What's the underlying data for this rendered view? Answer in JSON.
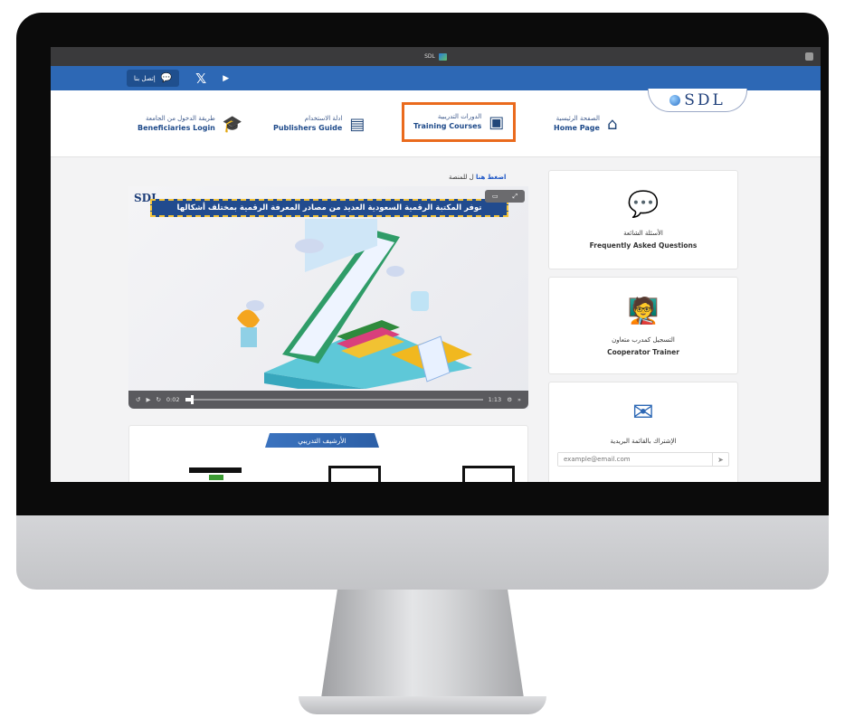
{
  "window": {
    "title": "SDL"
  },
  "topbar": {
    "contact_label": "إتصل بنا"
  },
  "logo": {
    "text": "SDL"
  },
  "menu": {
    "home": {
      "ar": "الصفحة الرئيسية",
      "en": "Home Page"
    },
    "training": {
      "ar": "الدورات التدريبية",
      "en": "Training Courses"
    },
    "publishers": {
      "ar": "ادلة الاستخدام",
      "en": "Publishers Guide"
    },
    "beneficiaries": {
      "ar": "طريقة الدخول من الجامعة",
      "en": "Beneficiaries Login"
    }
  },
  "content": {
    "link_prefix": "ل للمنصة",
    "link_action": "اضغط هنا",
    "video_logo": "SDL",
    "video_banner": "توفر المكتبة الرقمية السعودية العديد من مصادر المعرفة الرقمية بمختلف أشكالها",
    "video_time_current": "0:02",
    "video_time_total": "1:13",
    "video_progress": 0.02,
    "archive_title": "الأرشيف التدريبي"
  },
  "cards": {
    "faq": {
      "ar": "الأسئلة الشائعة",
      "en": "Frequently Asked Questions",
      "icon": "speech-bubbles-icon"
    },
    "trainer": {
      "ar": "التسجيل كمدرب متعاون",
      "en": "Cooperator Trainer",
      "icon": "presenter-icon"
    },
    "newsletter": {
      "ar": "الإشتراك بالقائمة البريدية",
      "placeholder": "example@email.com",
      "icon": "envelope-icon"
    }
  },
  "colors": {
    "brand_blue": "#2d68b5",
    "highlight": "#ea6a1d",
    "accent_orange": "#e8895b"
  }
}
